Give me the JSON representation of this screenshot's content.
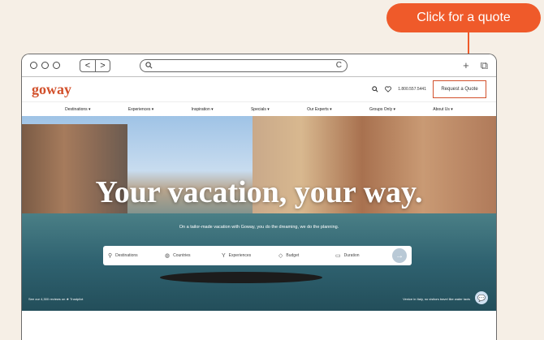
{
  "callout": {
    "label": "Click for a quote"
  },
  "browser": {
    "back": "<",
    "forward": ">",
    "search_icon": "search-icon",
    "reload": "C",
    "new_tab": "+",
    "tabs": "⧉"
  },
  "site": {
    "logo": "goway",
    "phone": "1.800.557.5441",
    "quote_button": "Request a Quote",
    "menu": [
      "Destinations ▾",
      "Experiences ▾",
      "Inspiration ▾",
      "Specials ▾",
      "Our Experts ▾",
      "Groups Only ▾",
      "About Us ▾"
    ],
    "hero": {
      "headline": "Your vacation, your way.",
      "subline": "On a tailor-made vacation with Goway, you do the dreaming, we do the planning.",
      "search": {
        "destinations": "Destinations",
        "countries": "Countries",
        "experiences": "Experiences",
        "budget": "Budget",
        "duration": "Duration",
        "go": "→"
      },
      "footnote_left": "See our 4,300 reviews on ★ Trustpilot",
      "footnote_right": "Venice in Italy, no visitors travel like water taxis"
    }
  }
}
